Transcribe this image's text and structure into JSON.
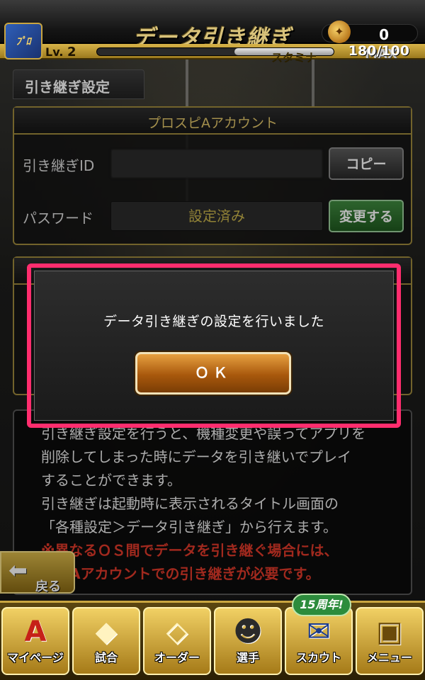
{
  "header": {
    "logo_text": "ﾌﾟﾛ",
    "title": "データ引き継ぎ",
    "coin_value": "0"
  },
  "status": {
    "level_prefix": "Lv.",
    "level_value": "2",
    "stamina_label": "スタミナ",
    "stamina_max_label": "MAX",
    "stamina_value": "180/100"
  },
  "section_tab": "引き継ぎ設定",
  "account_panel": {
    "heading": "プロスピAアカウント",
    "id_label": "引き継ぎID",
    "id_value": "",
    "copy_button": "コピー",
    "password_label": "パスワード",
    "password_value": "設定済み",
    "change_button": "変更する"
  },
  "description": {
    "lines": [
      "引き継ぎ設定を行うと、機種変更や誤ってアプリを",
      "削除してしまった時にデータを引き継いでプレイ",
      "することができます。",
      "引き継ぎは起動時に表示されるタイトル画面の",
      "「各種設定＞データ引き継ぎ」から行えます。"
    ],
    "warning_lines": [
      "※異なるＯＳ間でデータを引き継ぐ場合には、",
      "スピAアカウントでの引き継ぎが必要です。"
    ]
  },
  "back_button": "戻る",
  "bottom_nav": {
    "items": [
      {
        "label": "マイページ",
        "glyph": "A"
      },
      {
        "label": "試合",
        "glyph": "◆"
      },
      {
        "label": "オーダー",
        "glyph": "◇"
      },
      {
        "label": "選手",
        "glyph": "☻"
      },
      {
        "label": "スカウト",
        "glyph": "✉"
      },
      {
        "label": "メニュー",
        "glyph": "▣"
      }
    ],
    "badge": "15周年!"
  },
  "modal": {
    "message": "データ引き継ぎの設定を行いました",
    "ok_button": "ＯＫ"
  },
  "colors": {
    "accent_gold": "#c9a540",
    "highlight_pink": "#ff2d6e",
    "warning_red": "#e03a2a"
  }
}
